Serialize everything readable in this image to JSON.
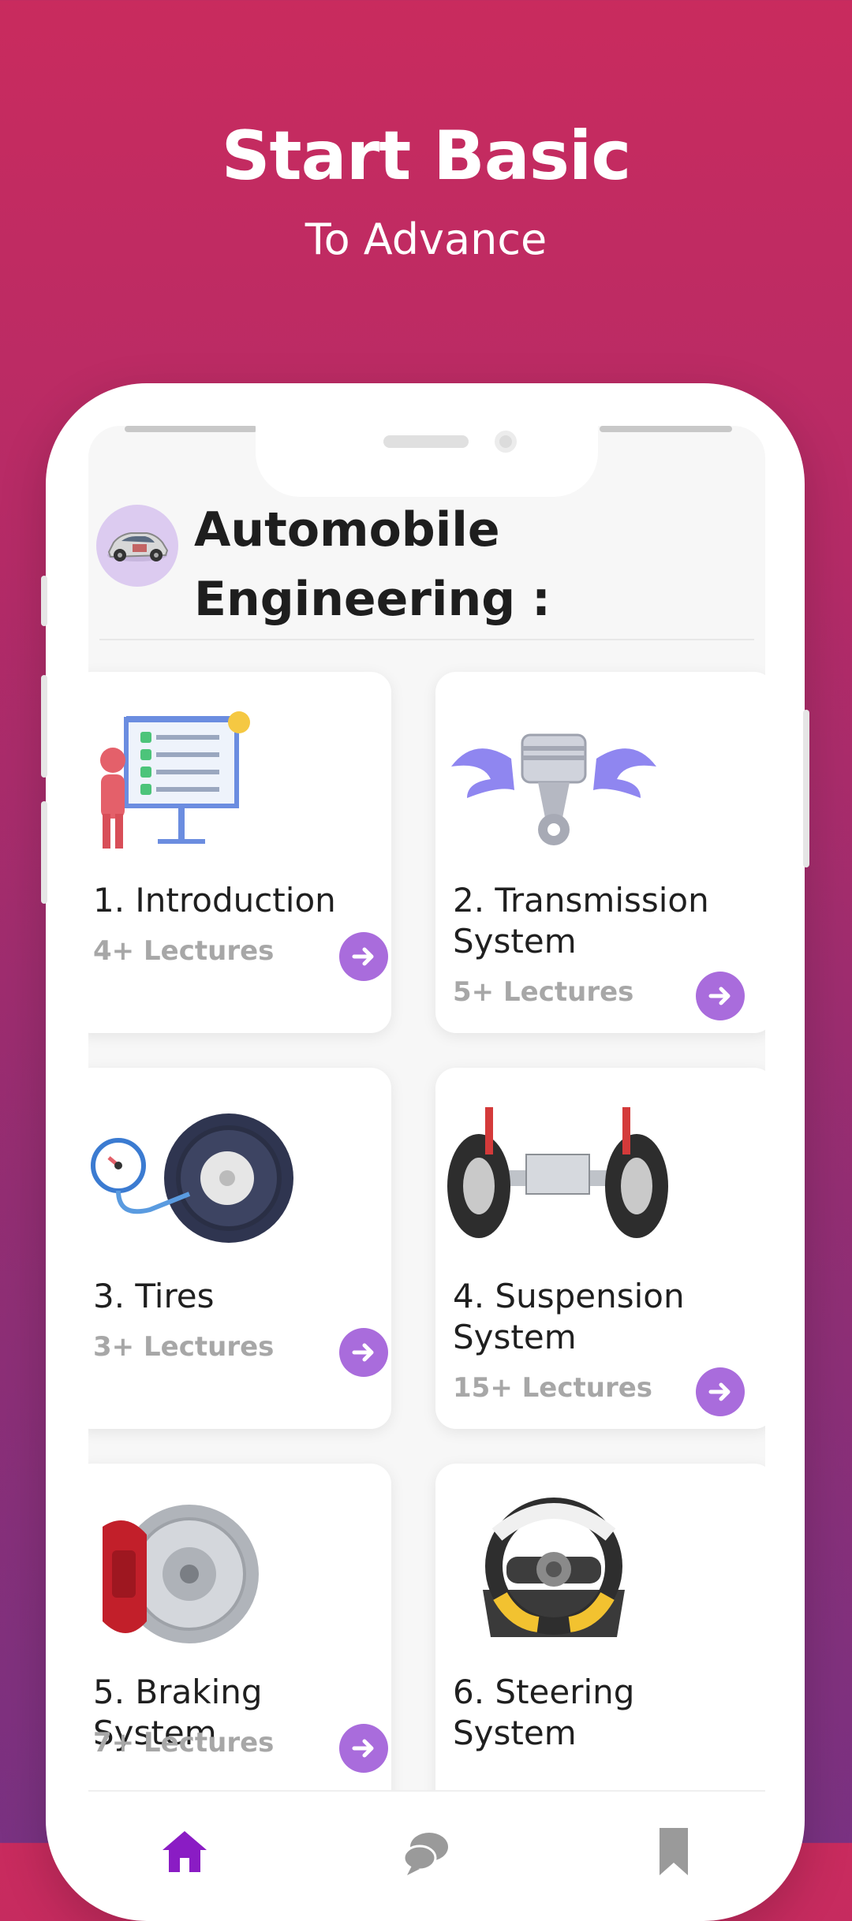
{
  "hero": {
    "title": "Start Basic",
    "subtitle": "To Advance"
  },
  "app": {
    "title": "Automobile Engineering :"
  },
  "colors": {
    "accent": "#a96cdc",
    "nav_active": "#8a1cc4",
    "nav_inactive": "#9a9a9a"
  },
  "courses": [
    {
      "title": "1. Introduction",
      "lectures": "4+ Lectures",
      "icon": "presentation-board-icon"
    },
    {
      "title": "2. Transmission System",
      "lectures": "5+ Lectures",
      "icon": "winged-piston-icon"
    },
    {
      "title": "3. Tires",
      "lectures": "3+ Lectures",
      "icon": "tire-pressure-icon"
    },
    {
      "title": "4. Suspension System",
      "lectures": "15+ Lectures",
      "icon": "suspension-axle-icon"
    },
    {
      "title": "5. Braking System",
      "lectures": "7+ Lectures",
      "icon": "brake-disc-icon"
    },
    {
      "title": "6. Steering System",
      "lectures": "",
      "icon": "steering-wheel-icon"
    }
  ],
  "nav": [
    {
      "name": "home",
      "icon": "home-icon",
      "active": true
    },
    {
      "name": "chat",
      "icon": "chat-icon",
      "active": false
    },
    {
      "name": "bookmark",
      "icon": "bookmark-icon",
      "active": false
    }
  ]
}
